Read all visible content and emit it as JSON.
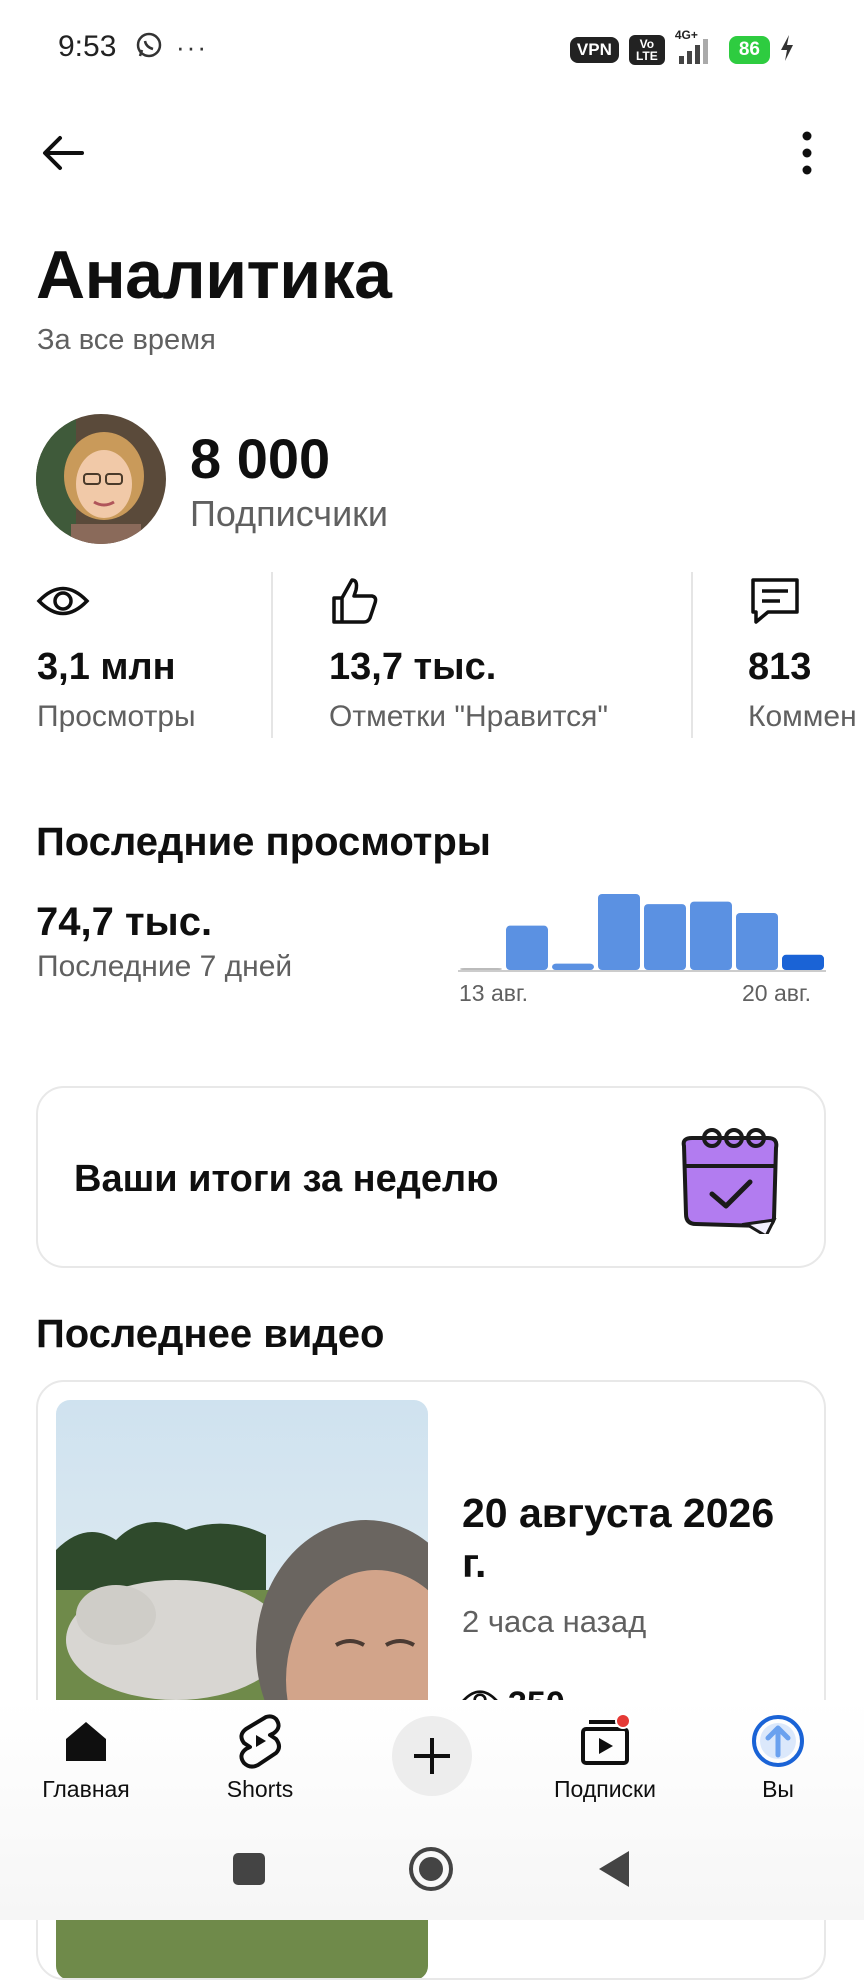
{
  "status_bar": {
    "time": "9:53",
    "vpn": "VPN",
    "volte": "Vo LTE",
    "network": "4G+",
    "battery": "86"
  },
  "header": {
    "title": "Аналитика",
    "subtitle": "За все время"
  },
  "channel": {
    "subscribers_count": "8 000",
    "subscribers_label": "Подписчики"
  },
  "stats": [
    {
      "value": "3,1 млн",
      "label": "Просмотры",
      "icon": "eye-icon"
    },
    {
      "value": "13,7 тыс.",
      "label": "Отметки \"Нравится\"",
      "icon": "thumb-up-icon"
    },
    {
      "value": "813",
      "label": "Коммен",
      "icon": "comment-icon"
    }
  ],
  "recent_views": {
    "heading": "Последние просмотры",
    "value": "74,7 тыс.",
    "period": "Последние 7 дней",
    "chart_start": "13 авг.",
    "chart_end": "20 авг."
  },
  "chart_data": {
    "type": "bar",
    "categories": [
      "13 авг.",
      "",
      "",
      "",
      "",
      "",
      "",
      "20 авг."
    ],
    "values": [
      1,
      35,
      5,
      60,
      52,
      54,
      45,
      12
    ],
    "highlight_last": true,
    "colors": {
      "bar": "#5b91e2",
      "last": "#1a63d6",
      "baseline": "#cccccc"
    }
  },
  "weekly": {
    "title": "Ваши итоги за неделю"
  },
  "latest_video": {
    "heading": "Последнее видео",
    "date": "20 августа 2026 г.",
    "ago": "2 часа назад",
    "views": "350"
  },
  "nav": {
    "home": "Главная",
    "shorts": "Shorts",
    "subscriptions": "Подписки",
    "you": "Вы"
  },
  "colors": {
    "accent": "#1a63d6",
    "battery": "#2ecc40",
    "notification_dot": "#e53935",
    "weekly_icon": "#b27cf0"
  }
}
